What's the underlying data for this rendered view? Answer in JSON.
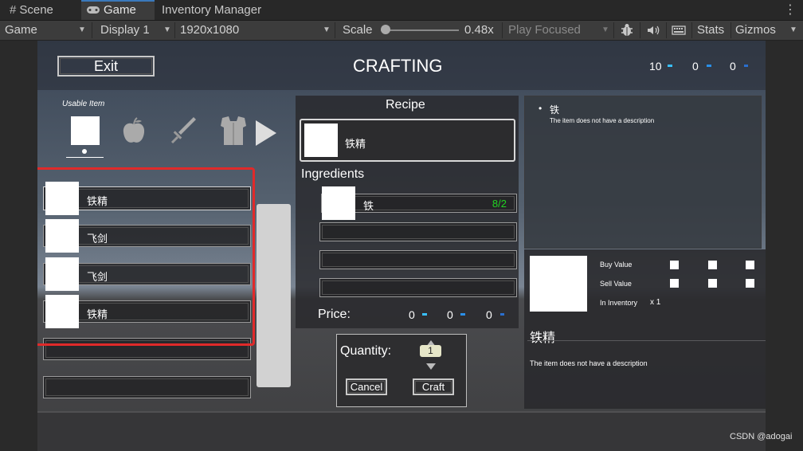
{
  "editor": {
    "tabs": [
      "Scene",
      "Game",
      "Inventory Manager"
    ],
    "tab_icons": [
      "grid-icon",
      "gamepad-icon"
    ],
    "toolbar": {
      "view_mode": "Game",
      "display": "Display 1",
      "resolution": "1920x1080",
      "scale_label": "Scale",
      "scale_value": "0.48x",
      "play_mode": "Play Focused",
      "stats": "Stats",
      "gizmos": "Gizmos"
    }
  },
  "game": {
    "exit_label": "Exit",
    "title": "CRAFTING",
    "currencies": [
      "10",
      "0",
      "0"
    ],
    "usable_item_label": "Usable Item",
    "category_icons": [
      "blank-slot-icon",
      "apple-icon",
      "sword-icon",
      "armor-icon",
      "next-arrow-icon"
    ],
    "item_list": [
      "铁精",
      "飞剑",
      "飞剑",
      "铁精",
      "",
      ""
    ],
    "recipe": {
      "header": "Recipe",
      "result_name": "铁精",
      "ingredients_label": "Ingredients",
      "ingredients": [
        {
          "name": "铁",
          "count": "8/2"
        },
        {
          "name": "",
          "count": ""
        },
        {
          "name": "",
          "count": ""
        },
        {
          "name": "",
          "count": ""
        }
      ],
      "price_label": "Price:",
      "price_values": [
        "0",
        "0",
        "0"
      ]
    },
    "quantity": {
      "label": "Quantity:",
      "value": "1",
      "cancel_label": "Cancel",
      "craft_label": "Craft"
    },
    "tooltip": {
      "bullet": "•",
      "name": "铁",
      "description": "The item does not have a description"
    },
    "details": {
      "buy_label": "Buy Value",
      "sell_label": "Sell Value",
      "inventory_label": "In Inventory",
      "inventory_count": "x 1",
      "name": "铁精",
      "description": "The item does not have a description"
    },
    "highlight_color": "#e02a2a",
    "success_color": "#21d321"
  },
  "watermark": "CSDN @adogai"
}
